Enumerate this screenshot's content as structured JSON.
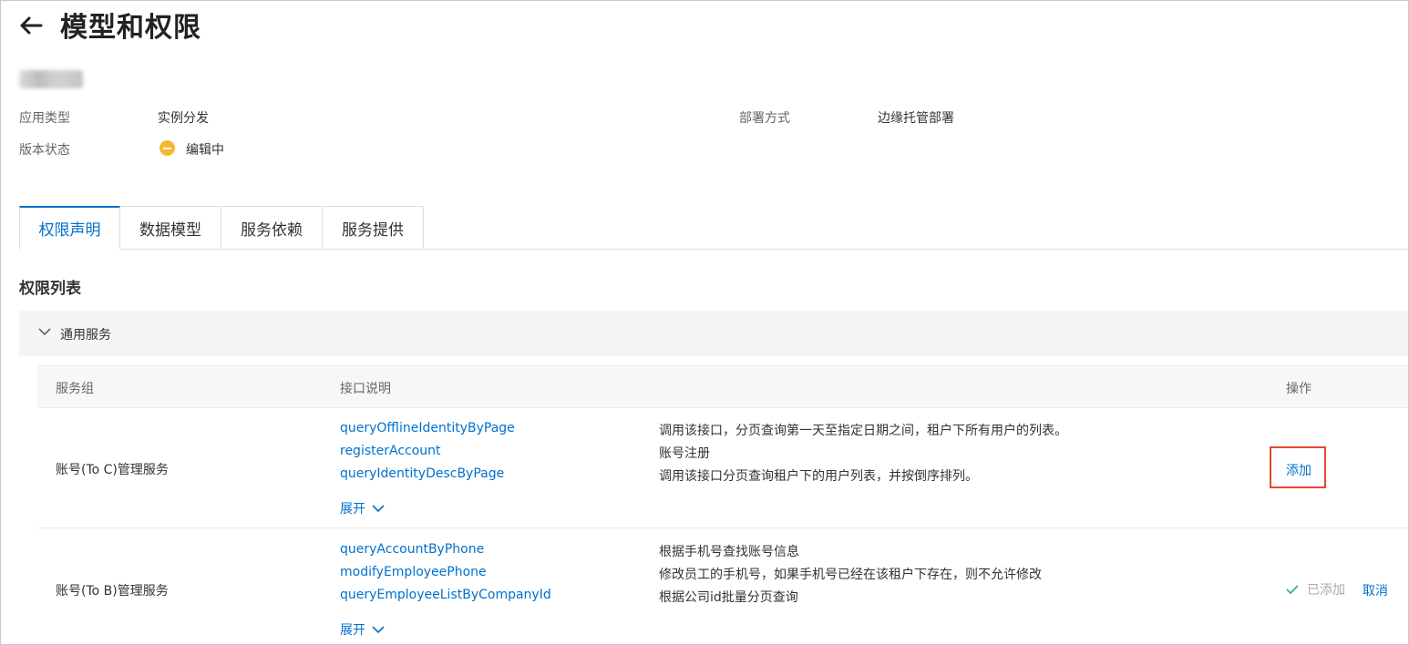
{
  "page": {
    "title": "模型和权限",
    "back_icon": "arrow-left-icon"
  },
  "info": {
    "app_type_label": "应用类型",
    "app_type_value": "实例分发",
    "deploy_label": "部署方式",
    "deploy_value": "边缘托管部署",
    "status_label": "版本状态",
    "status_value": "编辑中",
    "status_color": "#f5b82e"
  },
  "tabs": [
    {
      "label": "权限声明",
      "active": true
    },
    {
      "label": "数据模型",
      "active": false
    },
    {
      "label": "服务依赖",
      "active": false
    },
    {
      "label": "服务提供",
      "active": false
    }
  ],
  "section": {
    "title": "权限列表",
    "group_label": "通用服务"
  },
  "table": {
    "headers": {
      "group": "服务组",
      "api": "接口说明",
      "action": "操作"
    },
    "rows": [
      {
        "group": "账号(To C)管理服务",
        "apis": [
          {
            "name": "queryOfflineIdentityByPage",
            "desc": "调用该接口，分页查询第一天至指定日期之间，租户下所有用户的列表。"
          },
          {
            "name": "registerAccount",
            "desc": "账号注册"
          },
          {
            "name": "queryIdentityDescByPage",
            "desc": "调用该接口分页查询租户下的用户列表，并按倒序排列。"
          }
        ],
        "expand_label": "展开",
        "action_label": "添加"
      },
      {
        "group": "账号(To B)管理服务",
        "apis": [
          {
            "name": "queryAccountByPhone",
            "desc": "根据手机号查找账号信息"
          },
          {
            "name": "modifyEmployeePhone",
            "desc": "修改员工的手机号，如果手机号已经在该租户下存在，则不允许修改"
          },
          {
            "name": "queryEmployeeListByCompanyId",
            "desc": "根据公司id批量分页查询"
          }
        ],
        "expand_label": "展开",
        "added_label": "已添加",
        "cancel_label": "取消"
      }
    ]
  },
  "colors": {
    "link": "#0070cc",
    "highlight_box": "#e8472f",
    "check": "#2fb57d"
  }
}
